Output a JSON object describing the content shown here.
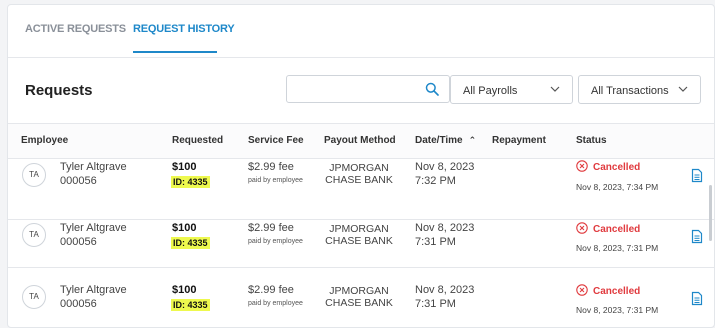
{
  "tabs": {
    "active_requests": "ACTIVE REQUESTS",
    "request_history": "REQUEST HISTORY"
  },
  "section": {
    "title": "Requests"
  },
  "search": {
    "value": "",
    "placeholder": "",
    "icon": "search-icon"
  },
  "filters": {
    "payrolls": "All Payrolls",
    "transactions": "All Transactions"
  },
  "table": {
    "headers": {
      "employee": "Employee",
      "requested": "Requested",
      "service_fee": "Service Fee",
      "payout_method": "Payout Method",
      "date_time": "Date/Time",
      "repayment": "Repayment",
      "status": "Status"
    },
    "rows": [
      {
        "initials": "TA",
        "name": "Tyler Altgrave",
        "emp_id": "000056",
        "amount": "$100",
        "req_id": "ID: 4335",
        "fee": "$2.99 fee",
        "fee_note": "paid by employee",
        "payout_line1": "JPMORGAN",
        "payout_line2": "CHASE BANK",
        "date": "Nov 8, 2023",
        "time": "7:32 PM",
        "repayment": "",
        "status": "Cancelled",
        "status_date": "Nov 8, 2023, 7:34 PM"
      },
      {
        "initials": "TA",
        "name": "Tyler Altgrave",
        "emp_id": "000056",
        "amount": "$100",
        "req_id": "ID: 4335",
        "fee": "$2.99 fee",
        "fee_note": "paid by employee",
        "payout_line1": "JPMORGAN",
        "payout_line2": "CHASE BANK",
        "date": "Nov 8, 2023",
        "time": "7:31 PM",
        "repayment": "",
        "status": "Cancelled",
        "status_date": "Nov 8, 2023, 7:31 PM"
      },
      {
        "initials": "TA",
        "name": "Tyler Altgrave",
        "emp_id": "000056",
        "amount": "$100",
        "req_id": "ID: 4335",
        "fee": "$2.99 fee",
        "fee_note": "paid by employee",
        "payout_line1": "JPMORGAN",
        "payout_line2": "CHASE BANK",
        "date": "Nov 8, 2023",
        "time": "7:31 PM",
        "repayment": "",
        "status": "Cancelled",
        "status_date": "Nov 8, 2023, 7:31 PM"
      }
    ]
  },
  "colors": {
    "accent": "#1e88c9",
    "cancelled": "#e03a3e",
    "highlight": "#eef94e"
  }
}
